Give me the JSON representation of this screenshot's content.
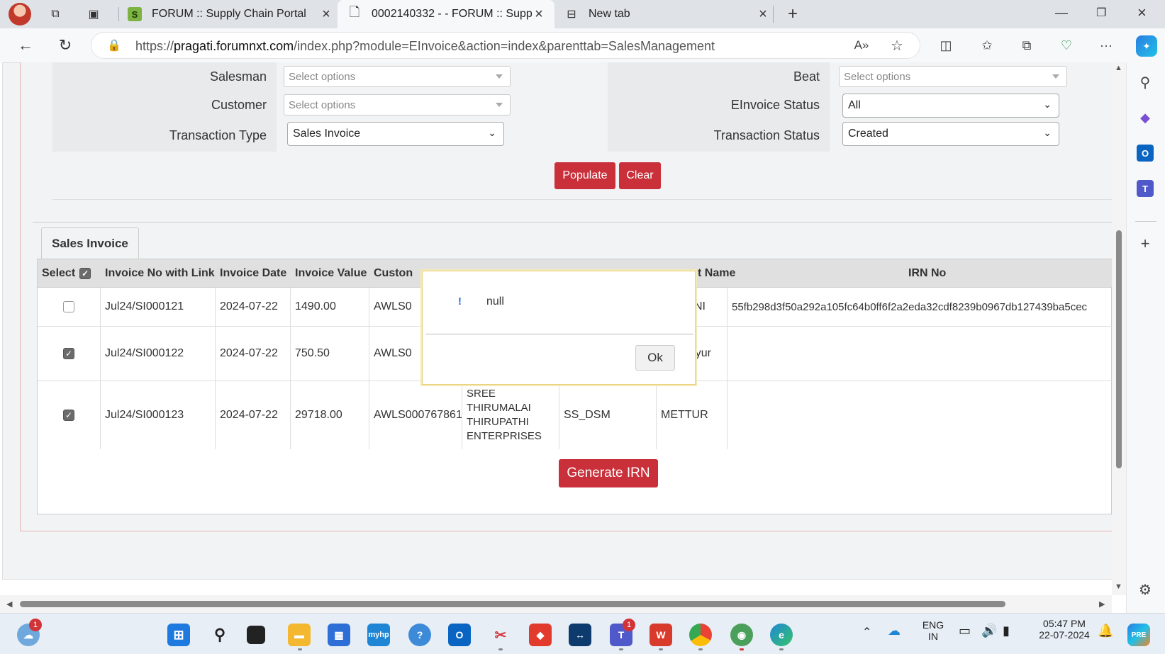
{
  "browser": {
    "tabs": [
      {
        "title": "FORUM :: Supply Chain Portal",
        "active": false
      },
      {
        "title": "0002140332 - - FORUM :: Supply",
        "active": true
      },
      {
        "title": "New tab",
        "active": false
      }
    ],
    "url_prefix": "https://",
    "url_host": "pragati.forumnxt.com",
    "url_path": "/index.php?module=EInvoice&action=index&parenttab=SalesManagement"
  },
  "filters": {
    "salesman": {
      "label": "Salesman",
      "placeholder": "Select options"
    },
    "beat": {
      "label": "Beat",
      "placeholder": "Select options"
    },
    "customer": {
      "label": "Customer",
      "placeholder": "Select options"
    },
    "einvoice_status": {
      "label": "EInvoice Status",
      "value": "All"
    },
    "transaction_type": {
      "label": "Transaction Type",
      "value": "Sales Invoice"
    },
    "transaction_status": {
      "label": "Transaction Status",
      "value": "Created"
    }
  },
  "actions": {
    "populate": "Populate",
    "clear": "Clear",
    "generate_irn": "Generate IRN"
  },
  "section_tab": "Sales Invoice",
  "grid": {
    "headers": {
      "select": "Select",
      "invoice_no": "Invoice No with Link",
      "invoice_date": "Invoice Date",
      "invoice_value": "Invoice Value",
      "customer": "Custon",
      "beat_name": "t Name",
      "irn_no": "IRN No"
    },
    "rows": [
      {
        "checked": false,
        "invoice_no": "Jul24/SI000121",
        "invoice_date": "2024-07-22",
        "invoice_value": "1490.00",
        "customer_code": "AWLS0",
        "customer_name": "",
        "salesman": "",
        "beat": "VANI",
        "irn": "55fb298d3f50a292a105fc64b0ff6f2a2eda32cdf8239b0967db127439ba5cec"
      },
      {
        "checked": true,
        "invoice_no": "Jul24/SI000122",
        "invoice_date": "2024-07-22",
        "invoice_value": "750.50",
        "customer_code": "AWLS0",
        "customer_name": "",
        "salesman": "",
        "beat": "nbiyur",
        "irn": ""
      },
      {
        "checked": true,
        "invoice_no": "Jul24/SI000123",
        "invoice_date": "2024-07-22",
        "invoice_value": "29718.00",
        "customer_code": "AWLS000767861",
        "customer_name": "SREE THIRUMALAI THIRUPATHI ENTERPRISES",
        "salesman": "SS_DSM",
        "beat": "METTUR",
        "irn": ""
      }
    ]
  },
  "dialog": {
    "icon": "!",
    "message": "null",
    "ok": "Ok"
  },
  "taskbar": {
    "lang_top": "ENG",
    "lang_bottom": "IN",
    "time": "05:47 PM",
    "date": "22-07-2024",
    "weather_badge": "1",
    "teams_badge": "1"
  }
}
